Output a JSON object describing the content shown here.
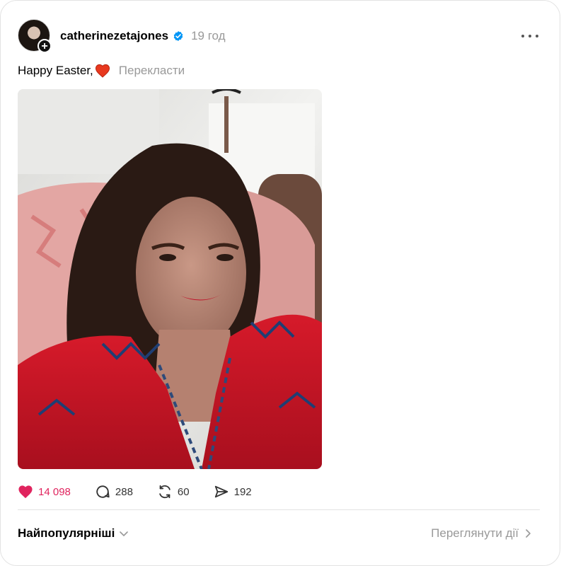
{
  "post": {
    "username": "catherinezetajones",
    "time": "19 год",
    "caption": "Happy Easter,",
    "translate_label": "Перекласти",
    "photo_alt": "selfie in red embroidered dress"
  },
  "actions": {
    "likes": "14 098",
    "comments": "288",
    "reposts": "60",
    "shares": "192"
  },
  "footer": {
    "sort_label": "Найпопулярніші",
    "view_activity_label": "Переглянути дії"
  },
  "colors": {
    "like": "#e0245e",
    "verified": "#0095f6"
  }
}
